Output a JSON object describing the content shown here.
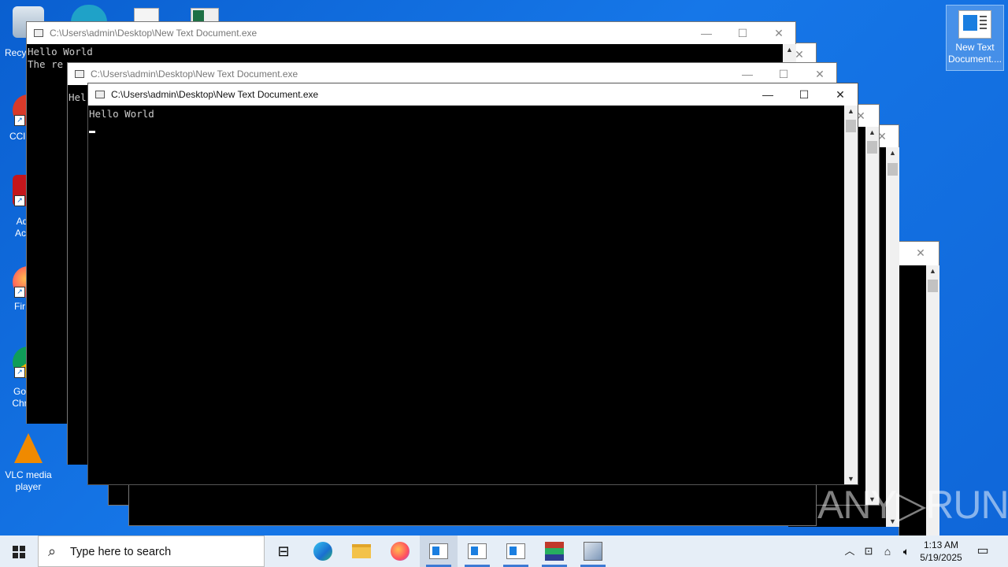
{
  "desktop": {
    "icons": [
      {
        "label": "Recy",
        "top": 0
      },
      {
        "label": "CCl",
        "top": 0
      },
      {
        "label": "Ad Acr",
        "top": 0
      },
      {
        "label": "Fir",
        "top": 0
      },
      {
        "label": "Go Chr",
        "top": 0
      },
      {
        "label": "VLC media player",
        "top": 0
      }
    ],
    "right_icon_label": "New Text Document...."
  },
  "windows": {
    "title": "C:\\Users\\admin\\Desktop\\New Text Document.exe",
    "back_console_line1": "Hello World",
    "back_console_line2": "The re",
    "mid_console_line1": "Hel",
    "front_console_line1": "Hello World",
    "minimize_glyph": "—",
    "maximize_glyph": "☐",
    "close_glyph": "✕"
  },
  "watermark": "ANY▷RUN",
  "taskbar": {
    "search_placeholder": "Type here to search",
    "clock_time": "1:13 AM",
    "clock_date": "5/19/2025"
  }
}
